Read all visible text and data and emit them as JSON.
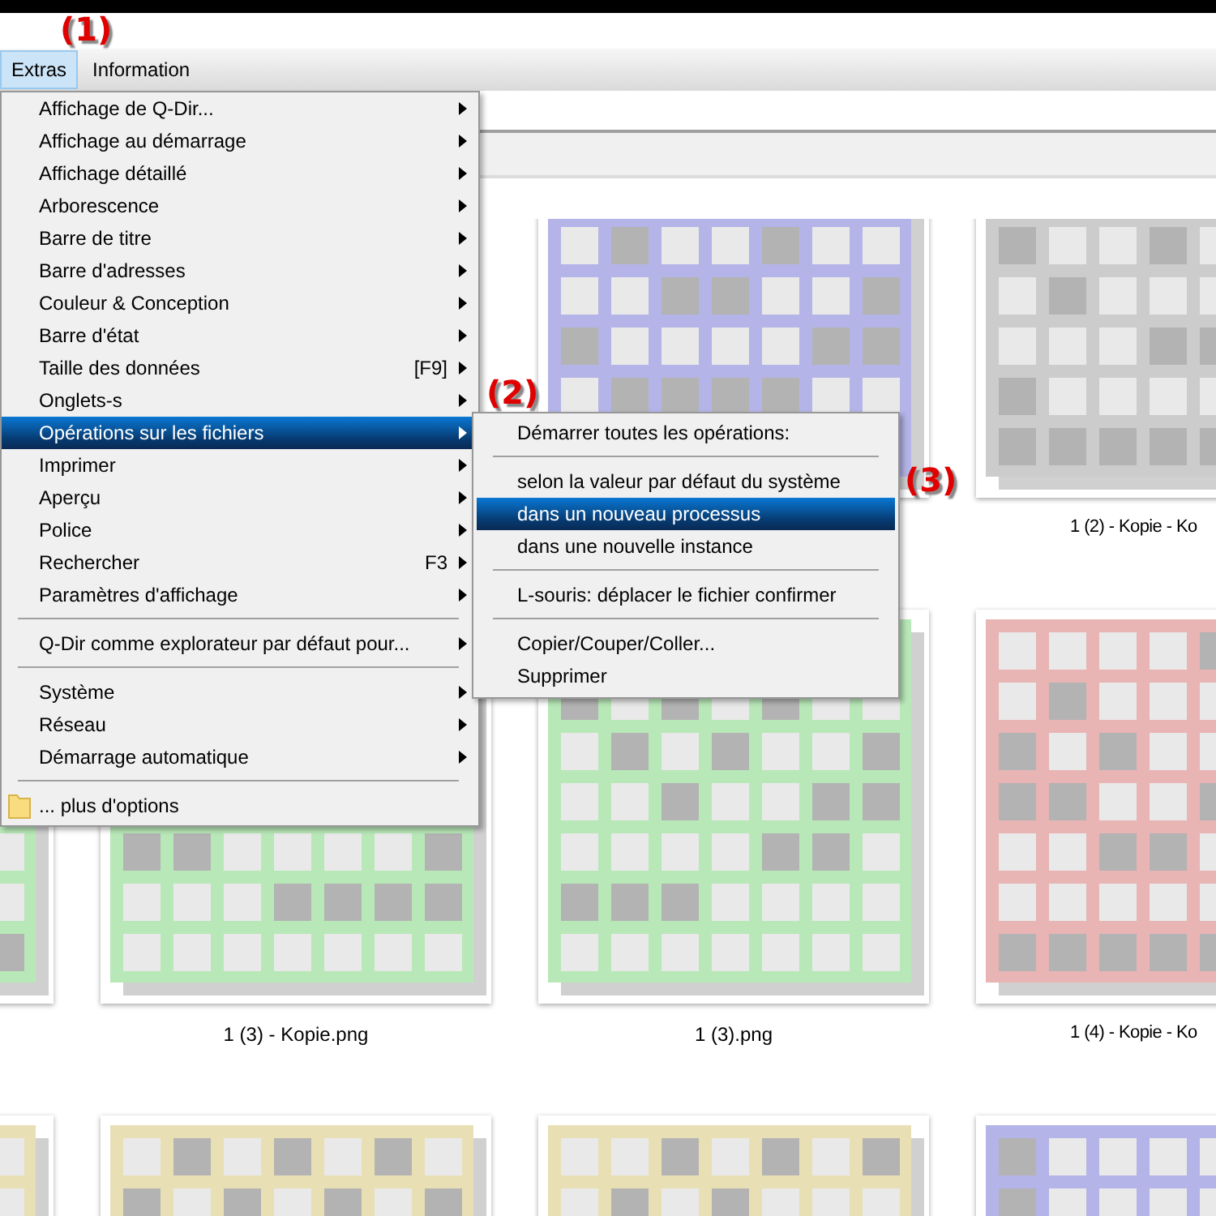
{
  "annotations": [
    {
      "text": "(1)"
    },
    {
      "text": "(2)"
    },
    {
      "text": "(3)"
    }
  ],
  "menu_bar": [
    {
      "label": "Extras",
      "selected": true
    },
    {
      "label": "Information",
      "selected": false
    }
  ],
  "extras_menu": {
    "items": [
      {
        "kind": "item",
        "label": "Affichage de Q-Dir...",
        "submenu": true,
        "selected": false
      },
      {
        "kind": "item",
        "label": "Affichage au démarrage",
        "submenu": true,
        "selected": false
      },
      {
        "kind": "item",
        "label": "Affichage détaillé",
        "submenu": true,
        "selected": false
      },
      {
        "kind": "item",
        "label": "Arborescence",
        "submenu": true,
        "selected": false
      },
      {
        "kind": "item",
        "label": "Barre de titre",
        "submenu": true,
        "selected": false
      },
      {
        "kind": "item",
        "label": "Barre d'adresses",
        "submenu": true,
        "selected": false
      },
      {
        "kind": "item",
        "label": "Couleur & Conception",
        "submenu": true,
        "selected": false
      },
      {
        "kind": "item",
        "label": "Barre d'état",
        "submenu": true,
        "selected": false
      },
      {
        "kind": "item",
        "label": "Taille des données",
        "shortcut": "[F9]",
        "submenu": true,
        "selected": false
      },
      {
        "kind": "item",
        "label": "Onglets-s",
        "submenu": true,
        "selected": false
      },
      {
        "kind": "item",
        "label": "Opérations sur les fichiers",
        "submenu": true,
        "selected": true
      },
      {
        "kind": "item",
        "label": "Imprimer",
        "submenu": true,
        "selected": false
      },
      {
        "kind": "item",
        "label": "Aperçu",
        "submenu": true,
        "selected": false
      },
      {
        "kind": "item",
        "label": "Police",
        "submenu": true,
        "selected": false
      },
      {
        "kind": "item",
        "label": "Rechercher",
        "shortcut": "F3",
        "submenu": true,
        "selected": false
      },
      {
        "kind": "item",
        "label": "Paramètres d'affichage",
        "submenu": true,
        "selected": false
      },
      {
        "kind": "separator"
      },
      {
        "kind": "item",
        "label": "Q-Dir comme explorateur par défaut pour...",
        "submenu": true,
        "selected": false
      },
      {
        "kind": "separator"
      },
      {
        "kind": "item",
        "label": "Système",
        "submenu": true,
        "selected": false
      },
      {
        "kind": "item",
        "label": "Réseau",
        "submenu": true,
        "selected": false
      },
      {
        "kind": "item",
        "label": "Démarrage automatique",
        "submenu": true,
        "selected": false
      },
      {
        "kind": "separator"
      },
      {
        "kind": "folder_item",
        "label": "... plus d'options",
        "selected": false
      }
    ]
  },
  "file_operations_submenu": {
    "items": [
      {
        "kind": "item",
        "label": "Démarrer toutes les opérations:",
        "selected": false
      },
      {
        "kind": "separator"
      },
      {
        "kind": "item",
        "label": "selon la valeur par défaut du système",
        "selected": false
      },
      {
        "kind": "item",
        "label": "dans un nouveau processus",
        "selected": true
      },
      {
        "kind": "item",
        "label": "dans une nouvelle instance",
        "selected": false
      },
      {
        "kind": "separator"
      },
      {
        "kind": "item",
        "label": "L-souris: déplacer le fichier confirmer",
        "selected": false
      },
      {
        "kind": "separator"
      },
      {
        "kind": "item",
        "label": "Copier/Couper/Coller...",
        "selected": false
      },
      {
        "kind": "item",
        "label": "Supprimer",
        "selected": false
      }
    ]
  },
  "files": {
    "rows": [
      {
        "tiles": [
          {
            "color": "#b4b4e8"
          },
          {
            "color": "#cccccc",
            "caption": "1 (2) - Kopie - Ko"
          }
        ]
      },
      {
        "tiles": [
          {
            "color": "#b8e8b8"
          },
          {
            "color": "#b8e8b8",
            "caption": "1 (3) - Kopie.png"
          },
          {
            "color": "#b8e8b8",
            "caption": "1 (3).png"
          },
          {
            "color": "#e8b4b4",
            "caption": "1 (4) - Kopie - Ko"
          }
        ]
      },
      {
        "tiles": [
          {
            "color": "#e8e0b4"
          },
          {
            "color": "#e8e0b4"
          },
          {
            "color": "#e8e0b4"
          },
          {
            "color": "#b4b4e8"
          }
        ]
      }
    ]
  }
}
